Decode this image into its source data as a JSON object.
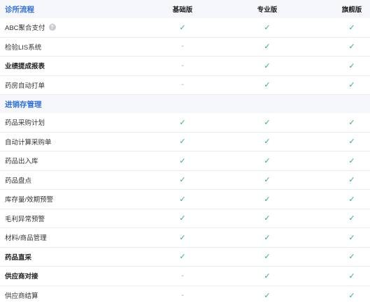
{
  "columns": [
    "基础版",
    "专业版",
    "旗舰版"
  ],
  "icons": {
    "check": "check-icon",
    "help": "question-circle-icon",
    "check_color": "#2eb36b",
    "section_color": "#2f6fe0"
  },
  "sections": [
    {
      "title": "诊所流程",
      "items": [
        {
          "label": "ABC聚合支付",
          "bold": false,
          "help": true,
          "values": [
            "✓",
            "✓",
            "✓"
          ]
        },
        {
          "label": "检验LIS系统",
          "bold": false,
          "help": false,
          "values": [
            "-",
            "✓",
            "✓"
          ]
        },
        {
          "label": "业绩提成报表",
          "bold": true,
          "help": false,
          "values": [
            "-",
            "✓",
            "✓"
          ]
        },
        {
          "label": "药房自动打单",
          "bold": false,
          "help": false,
          "values": [
            "-",
            "✓",
            "✓"
          ]
        }
      ]
    },
    {
      "title": "进销存管理",
      "items": [
        {
          "label": "药品采购计划",
          "bold": false,
          "help": false,
          "values": [
            "✓",
            "✓",
            "✓"
          ]
        },
        {
          "label": "自动计算采购单",
          "bold": false,
          "help": false,
          "values": [
            "✓",
            "✓",
            "✓"
          ]
        },
        {
          "label": "药品出入库",
          "bold": false,
          "help": false,
          "values": [
            "✓",
            "✓",
            "✓"
          ]
        },
        {
          "label": "药品盘点",
          "bold": false,
          "help": false,
          "values": [
            "✓",
            "✓",
            "✓"
          ]
        },
        {
          "label": "库存量/效期预警",
          "bold": false,
          "help": false,
          "values": [
            "✓",
            "✓",
            "✓"
          ]
        },
        {
          "label": "毛利异常预警",
          "bold": false,
          "help": false,
          "values": [
            "✓",
            "✓",
            "✓"
          ]
        },
        {
          "label": "材料/商品管理",
          "bold": false,
          "help": false,
          "values": [
            "✓",
            "✓",
            "✓"
          ]
        },
        {
          "label": "药品直采",
          "bold": true,
          "help": false,
          "values": [
            "✓",
            "✓",
            "✓"
          ]
        },
        {
          "label": "供应商对接",
          "bold": true,
          "help": false,
          "values": [
            "-",
            "✓",
            "✓"
          ]
        },
        {
          "label": "供应商结算",
          "bold": false,
          "help": false,
          "values": [
            "-",
            "✓",
            "✓"
          ]
        }
      ]
    }
  ]
}
